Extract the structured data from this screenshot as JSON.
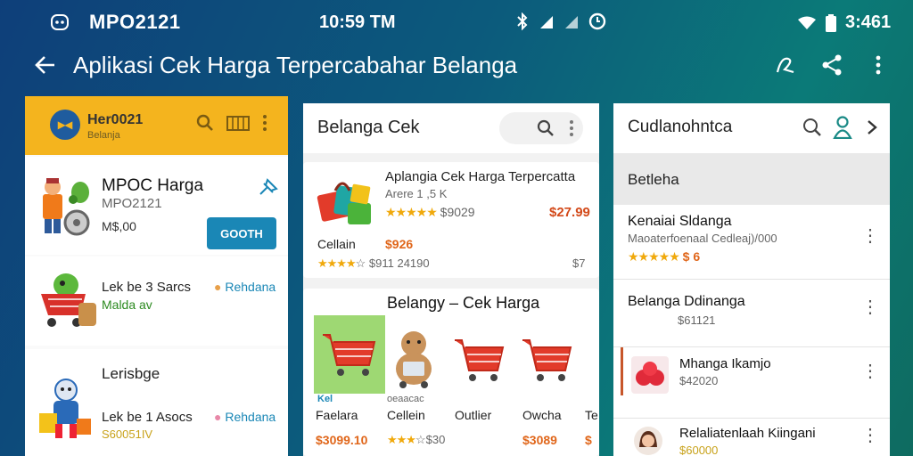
{
  "status_bar": {
    "app_label": "MPO2121",
    "time_center": "10:59 TM",
    "time_right": "3:461"
  },
  "app_bar": {
    "title": "Aplikasi Cek Harga Terpercabahar Belanga"
  },
  "panel1": {
    "brand_name": "Her0021",
    "brand_sub": "Belanja",
    "card1": {
      "title": "MPOC Harga",
      "code": "MPO2121",
      "price": "M$,00",
      "button": "GOOTH"
    },
    "card2": {
      "title": "Lek be 3 Sarcs",
      "tag": "Rehdana",
      "sub": "Malda av"
    },
    "card3": {
      "heading": "Lerisbge",
      "title": "Lek be 1 Asocs",
      "tag": "Rehdana",
      "sub": "S60051IV"
    }
  },
  "panel2": {
    "header": "Belanga Cek",
    "card1": {
      "title": "Aplangia Cek Harga Terpercatta",
      "meta": "Arere   1 ,5 K",
      "rating_price": "$9029",
      "price": "$27.99",
      "label": "Cellain",
      "label_price": "$926",
      "footer_price": "$911 24190",
      "footer_right": "$7"
    },
    "card2": {
      "title": "Belangy – Cek Harga",
      "badge": "Kel",
      "sub_small": "oeaacac",
      "items": [
        {
          "label": "Faelara",
          "price": "$3099.10"
        },
        {
          "label": "Cellein",
          "price": "$30"
        },
        {
          "label": "Outlier",
          "price": ""
        },
        {
          "label": "Owcha",
          "price": "$3089"
        },
        {
          "label": "Te",
          "price": "$"
        }
      ]
    }
  },
  "panel3": {
    "header": "Cudlanohntca",
    "sub": "Betleha",
    "items": [
      {
        "title": "Kenaiai Sldanga",
        "sub": "Maoaterfoenaal Cedleaj)/000",
        "rating": "$ 6"
      },
      {
        "title": "Belanga Ddinanga",
        "sub": "$61121"
      },
      {
        "title": "Mhanga Ikamjo",
        "sub": "$42020"
      },
      {
        "title": "Relaliatenlaah Kiingani",
        "sub": "$60000"
      }
    ]
  },
  "colors": {
    "panel1_header": "#f4b41e",
    "button": "#1a87b6",
    "price": "#e0661a",
    "stars": "#f0a90c",
    "green_text": "#2c8a20"
  }
}
